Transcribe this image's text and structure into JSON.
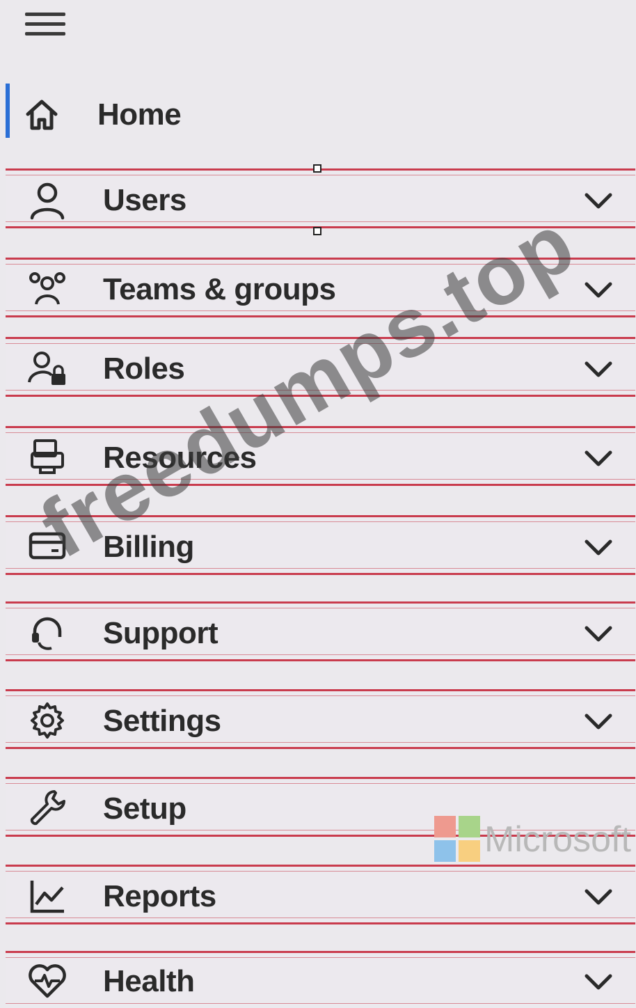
{
  "nav": {
    "home": {
      "label": "Home",
      "icon": "home-icon"
    },
    "items": [
      {
        "label": "Users",
        "icon": "user-icon",
        "chevron": true
      },
      {
        "label": "Teams & groups",
        "icon": "teams-icon",
        "chevron": true
      },
      {
        "label": "Roles",
        "icon": "roles-icon",
        "chevron": true
      },
      {
        "label": "Resources",
        "icon": "resources-icon",
        "chevron": true
      },
      {
        "label": "Billing",
        "icon": "billing-icon",
        "chevron": true
      },
      {
        "label": "Support",
        "icon": "support-icon",
        "chevron": true
      },
      {
        "label": "Settings",
        "icon": "gear-icon",
        "chevron": true
      },
      {
        "label": "Setup",
        "icon": "wrench-icon",
        "chevron": false
      },
      {
        "label": "Reports",
        "icon": "chart-icon",
        "chevron": true
      },
      {
        "label": "Health",
        "icon": "heart-icon",
        "chevron": true
      }
    ]
  },
  "watermark": {
    "text": "freedumps.top"
  },
  "logo": {
    "text": "Microsoft"
  },
  "colors": {
    "active": "#2b6fd6",
    "highlight_border": "#c93b4d",
    "background": "#ebe9ed"
  }
}
